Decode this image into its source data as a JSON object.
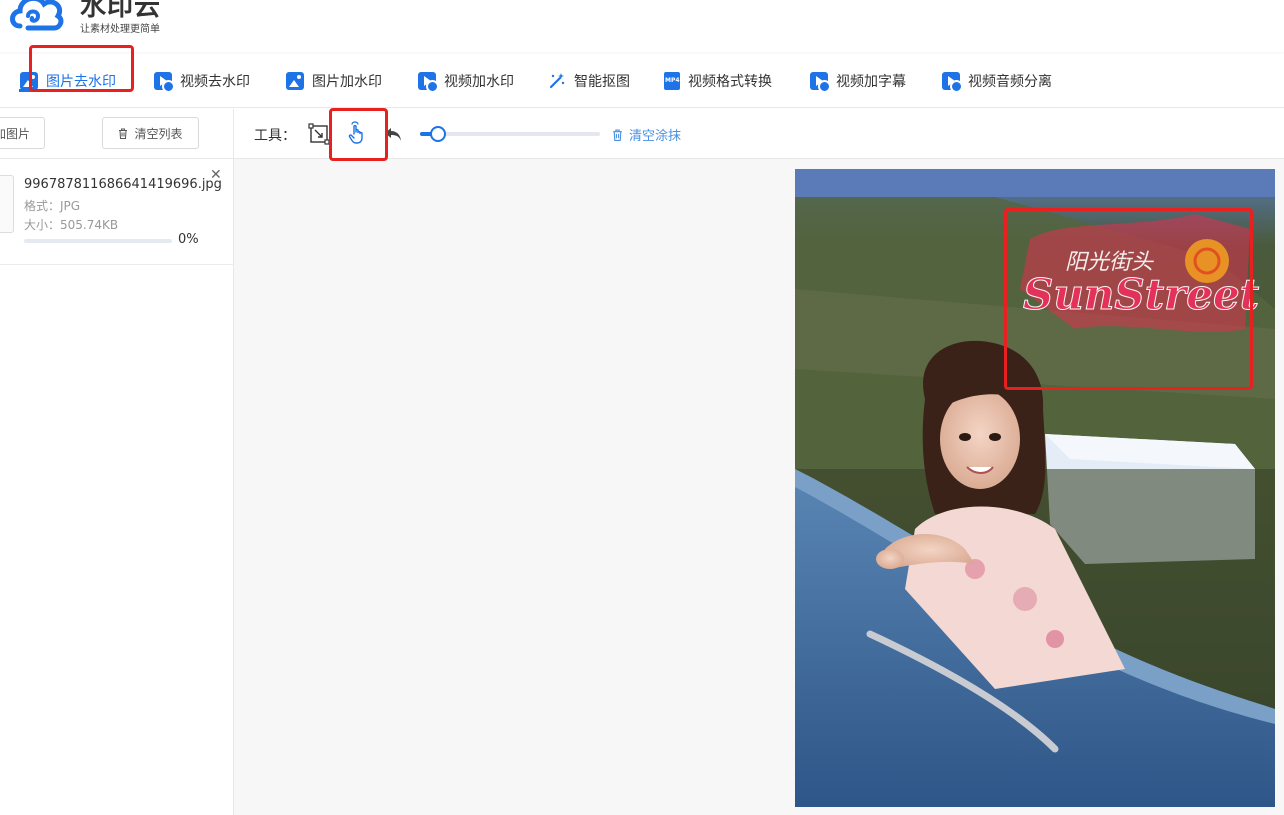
{
  "brand": {
    "name": "水印云",
    "slogan": "让素材处理更简单"
  },
  "tabs": [
    {
      "label": "图片去水印",
      "icon": "image-icon",
      "active": true
    },
    {
      "label": "视频去水印",
      "icon": "video-icon"
    },
    {
      "label": "图片加水印",
      "icon": "image-icon"
    },
    {
      "label": "视频加水印",
      "icon": "video-icon"
    },
    {
      "label": "智能抠图",
      "icon": "magic-wand-icon"
    },
    {
      "label": "视频格式转换",
      "icon": "mp4-file-icon"
    },
    {
      "label": "视频加字幕",
      "icon": "video-icon"
    },
    {
      "label": "视频音频分离",
      "icon": "video-icon"
    }
  ],
  "left": {
    "add_label": "加图片",
    "clear_label": "清空列表",
    "file": {
      "name": "996787811686641419696.jpg",
      "format": "格式：JPG",
      "size": "大小：505.74KB",
      "progress_text": "0%",
      "progress": 0
    }
  },
  "toolbar": {
    "tools_label": "工具：",
    "clear_smear_label": "清空涂抹",
    "brush_size": 0.1
  },
  "photo": {
    "watermark_cn": "阳光街头",
    "watermark_en": "SunStreet"
  },
  "colors": {
    "accent": "#1a73e8",
    "highlight": "#e82020"
  }
}
